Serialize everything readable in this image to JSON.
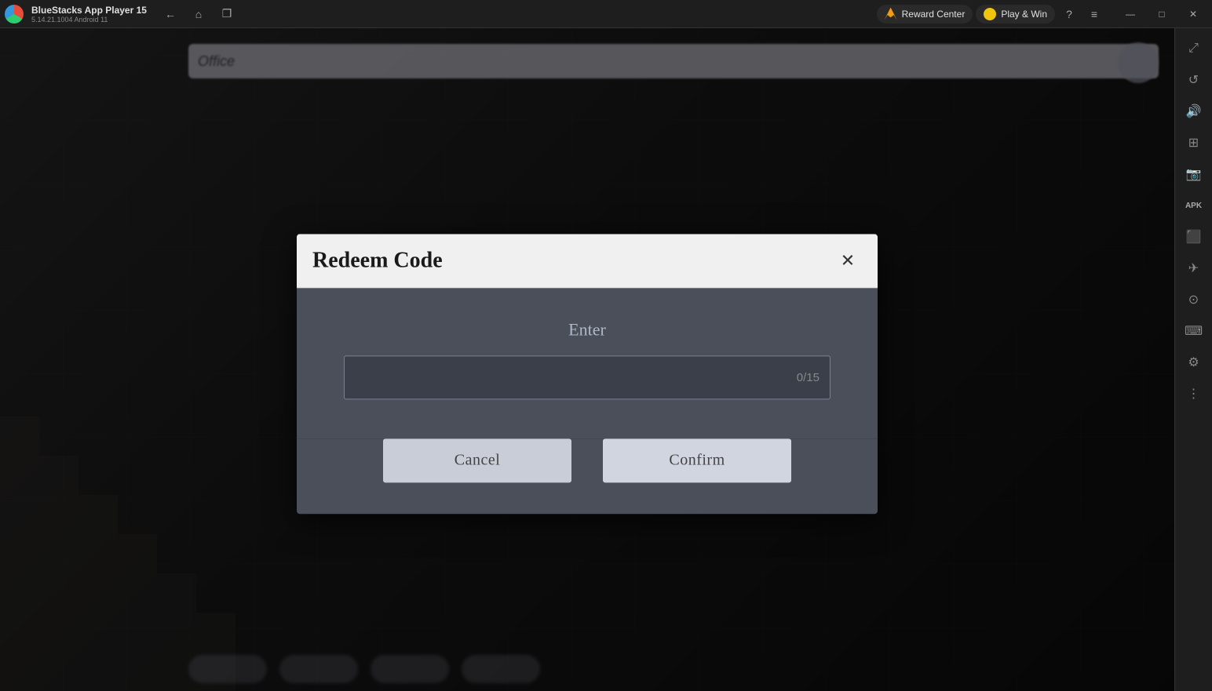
{
  "titlebar": {
    "app_name": "BlueStacks App Player 15",
    "app_version": "5.14.21.1004  Android 11",
    "reward_center_label": "Reward Center",
    "play_win_label": "Play & Win"
  },
  "window_controls": {
    "minimize": "—",
    "maximize": "□",
    "restore": "❐",
    "close": "✕"
  },
  "nav_buttons": {
    "back": "←",
    "home": "⌂",
    "copy": "❐"
  },
  "sidebar": {
    "icons": [
      "▶",
      "↺",
      "⬡",
      "⊞",
      "📷",
      "≡",
      "⬛",
      "✈",
      "⊙",
      "⌨",
      "⚙",
      "↑"
    ]
  },
  "dialog": {
    "title": "Redeem Code",
    "close_icon": "✕",
    "enter_label": "Enter",
    "input_placeholder": "",
    "input_counter": "0/15",
    "cancel_label": "Cancel",
    "confirm_label": "Confirm"
  },
  "ingame": {
    "topbar_text": "Office"
  }
}
